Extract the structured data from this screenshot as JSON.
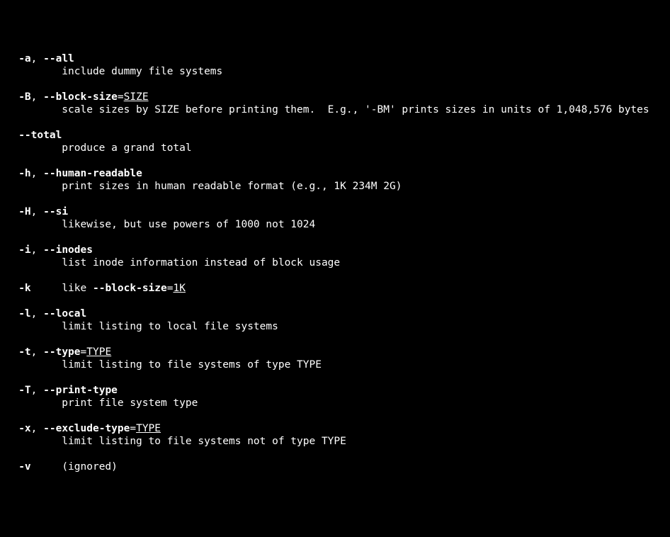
{
  "options": [
    {
      "flags_html": "   <span class='b'>-a</span>, <span class='b'>--all</span>",
      "desc": "          include dummy file systems"
    },
    {
      "flags_html": "   <span class='b'>-B</span>, <span class='b'>--block-size</span>=<span class='u'>SIZE</span>",
      "desc": "          scale sizes by SIZE before printing them.  E.g., '-BM' prints sizes in units of 1,048,576 bytes"
    },
    {
      "flags_html": "   <span class='b'>--total</span>",
      "desc": "          produce a grand total"
    },
    {
      "flags_html": "   <span class='b'>-h</span>, <span class='b'>--human-readable</span>",
      "desc": "          print sizes in human readable format (e.g., 1K 234M 2G)"
    },
    {
      "flags_html": "   <span class='b'>-H</span>, <span class='b'>--si</span>",
      "desc": "          likewise, but use powers of 1000 not 1024"
    },
    {
      "flags_html": "   <span class='b'>-i</span>, <span class='b'>--inodes</span>",
      "desc": "          list inode information instead of block usage"
    },
    {
      "flags_html": "   <span class='b'>-k</span>     like <span class='b'>--block-size</span>=<span class='u'>1K</span>",
      "desc": null
    },
    {
      "flags_html": "   <span class='b'>-l</span>, <span class='b'>--local</span>",
      "desc": "          limit listing to local file systems"
    },
    {
      "flags_html": "   <span class='b'>-t</span>, <span class='b'>--type</span>=<span class='u'>TYPE</span>",
      "desc": "          limit listing to file systems of type TYPE"
    },
    {
      "flags_html": "   <span class='b'>-T</span>, <span class='b'>--print-type</span>",
      "desc": "          print file system type"
    },
    {
      "flags_html": "   <span class='b'>-x</span>, <span class='b'>--exclude-type</span>=<span class='u'>TYPE</span>",
      "desc": "          limit listing to file systems not of type TYPE"
    },
    {
      "flags_html": "   <span class='b'>-v</span>     (ignored)",
      "desc": null
    }
  ],
  "options_plain": [
    {
      "flags": "-a, --all",
      "desc": "include dummy file systems"
    },
    {
      "flags": "-B, --block-size=SIZE",
      "desc": "scale sizes by SIZE before printing them.  E.g., '-BM' prints sizes in units of 1,048,576 bytes"
    },
    {
      "flags": "--total",
      "desc": "produce a grand total"
    },
    {
      "flags": "-h, --human-readable",
      "desc": "print sizes in human readable format (e.g., 1K 234M 2G)"
    },
    {
      "flags": "-H, --si",
      "desc": "likewise, but use powers of 1000 not 1024"
    },
    {
      "flags": "-i, --inodes",
      "desc": "list inode information instead of block usage"
    },
    {
      "flags": "-k     like --block-size=1K",
      "desc": null
    },
    {
      "flags": "-l, --local",
      "desc": "limit listing to local file systems"
    },
    {
      "flags": "-t, --type=TYPE",
      "desc": "limit listing to file systems of type TYPE"
    },
    {
      "flags": "-T, --print-type",
      "desc": "print file system type"
    },
    {
      "flags": "-x, --exclude-type=TYPE",
      "desc": "limit listing to file systems not of type TYPE"
    },
    {
      "flags": "-v     (ignored)",
      "desc": null
    }
  ]
}
